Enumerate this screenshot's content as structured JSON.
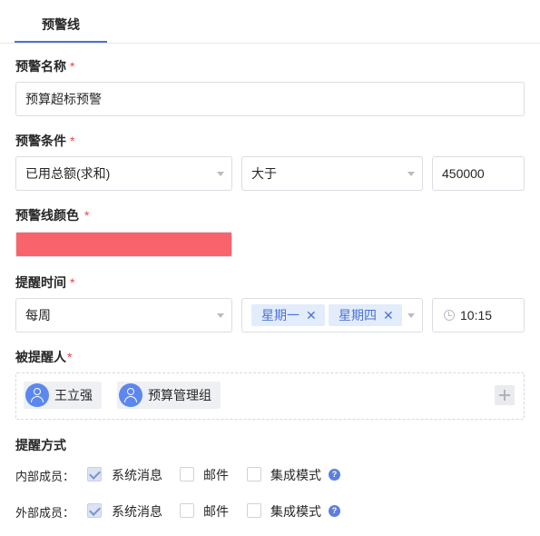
{
  "tabs": [
    {
      "label": "预警线",
      "active": true
    }
  ],
  "accent_color": "#4a72d8",
  "required_mark": "*",
  "form": {
    "name": {
      "label": "预警名称",
      "value": "预算超标预警"
    },
    "condition": {
      "label": "预警条件",
      "field": "已用总额(求和)",
      "operator": "大于",
      "value": "450000"
    },
    "line_color": {
      "label": "预警线颜色",
      "value": "#f9636b"
    },
    "remind_time": {
      "label": "提醒时间",
      "frequency": "每周",
      "days": [
        {
          "label": "星期一"
        },
        {
          "label": "星期四"
        }
      ],
      "remove_symbol": "✕",
      "time": "10:15"
    },
    "recipients": {
      "label": "被提醒人",
      "people": [
        {
          "name": "王立强"
        },
        {
          "name": "预算管理组"
        }
      ]
    },
    "notify": {
      "label": "提醒方式",
      "rows": [
        {
          "label": "内部成员：",
          "options": [
            {
              "label": "系统消息",
              "checked": true
            },
            {
              "label": "邮件",
              "checked": false
            },
            {
              "label": "集成模式",
              "checked": false
            }
          ],
          "help_symbol": "?"
        },
        {
          "label": "外部成员：",
          "options": [
            {
              "label": "系统消息",
              "checked": true
            },
            {
              "label": "邮件",
              "checked": false
            },
            {
              "label": "集成模式",
              "checked": false
            }
          ],
          "help_symbol": "?"
        }
      ]
    }
  }
}
